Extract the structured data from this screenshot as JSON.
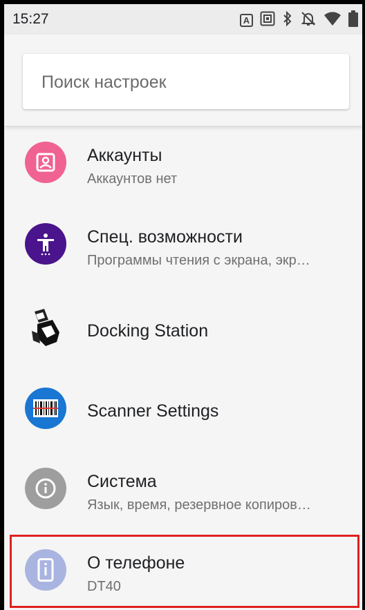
{
  "status_bar": {
    "time": "15:27",
    "icons": [
      "a-box-icon",
      "settings-box-icon",
      "bluetooth-icon",
      "alarm-off-icon",
      "wifi-icon",
      "battery-icon"
    ],
    "a_label": "A"
  },
  "search": {
    "placeholder": "Поиск настроек"
  },
  "items": [
    {
      "title": "Аккаунты",
      "subtitle": "Аккаунтов нет",
      "icon": "account-icon",
      "color": "#f06292"
    },
    {
      "title": "Спец. возможности",
      "subtitle": "Программы чтения с экрана, экр…",
      "icon": "accessibility-icon",
      "color": "#4a148c"
    },
    {
      "title": "Docking Station",
      "subtitle": "",
      "icon": "docking-station-icon",
      "color": "#ffffff"
    },
    {
      "title": "Scanner Settings",
      "subtitle": "",
      "icon": "barcode-scanner-icon",
      "color": "#1976d2"
    },
    {
      "title": "Система",
      "subtitle": "Язык, время, резервное копиров…",
      "icon": "info-icon",
      "color": "#9e9e9e"
    },
    {
      "title": "О телефоне",
      "subtitle": "DT40",
      "icon": "phone-info-icon",
      "color": "#aab4e0"
    }
  ],
  "highlight_color": "#e02020"
}
